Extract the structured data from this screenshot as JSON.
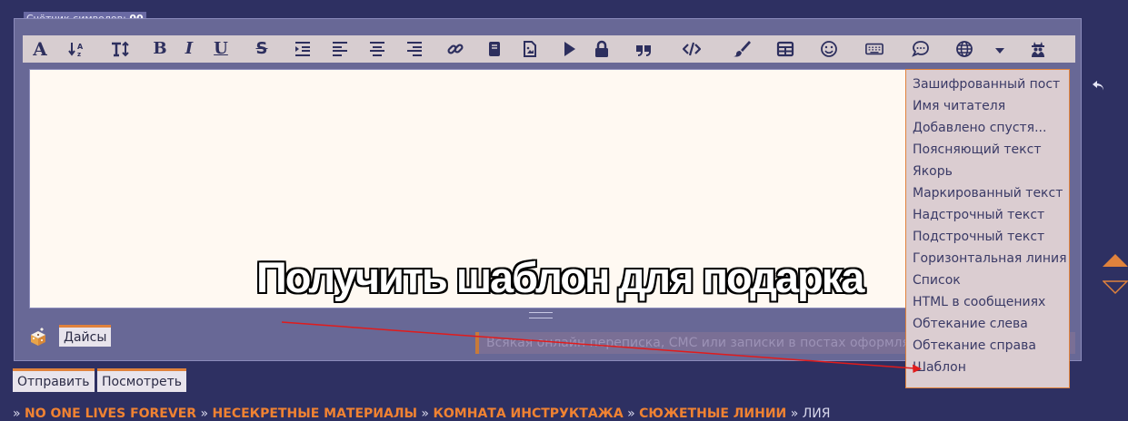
{
  "char_counter": {
    "label": "Счётчик символов:",
    "value": "00"
  },
  "toolbar": {
    "buttons": [
      {
        "icon": "font-icon"
      },
      {
        "icon": "font-size-icon"
      },
      {
        "icon": "text-height-icon"
      },
      {
        "icon": "bold-icon",
        "glyph": "B"
      },
      {
        "icon": "italic-icon",
        "glyph": "I"
      },
      {
        "icon": "underline-icon",
        "glyph": "U"
      },
      {
        "icon": "strikethrough-icon",
        "glyph": "S"
      },
      {
        "icon": "indent-icon"
      },
      {
        "icon": "align-left-icon"
      },
      {
        "icon": "align-center-icon"
      },
      {
        "icon": "align-right-icon"
      },
      {
        "icon": "link-icon"
      },
      {
        "icon": "book-icon"
      },
      {
        "icon": "image-file-icon"
      },
      {
        "icon": "play-icon"
      },
      {
        "icon": "lock-icon"
      },
      {
        "icon": "quote-icon"
      },
      {
        "icon": "code-icon"
      },
      {
        "icon": "paint-brush-icon"
      },
      {
        "icon": "table-icon"
      },
      {
        "icon": "smiley-icon"
      },
      {
        "icon": "keyboard-icon"
      },
      {
        "icon": "speech-bubble-icon"
      },
      {
        "icon": "globe-icon"
      },
      {
        "icon": "caret-down-icon"
      },
      {
        "icon": "user-secret-icon"
      }
    ]
  },
  "overlay_title": "Получить шаблон для подарка",
  "dropdown": {
    "items": [
      "Зашифрованный пост",
      "Имя читателя",
      "Добавлено спустя...",
      "Поясняющий текст",
      "Якорь",
      "Маркированный текст",
      "Надстрочный текст",
      "Подстрочный текст",
      "Горизонтальная линия",
      "Список",
      "HTML в сообщениях",
      "Обтекание слева",
      "Обтекание справа",
      "Шаблон"
    ]
  },
  "dice": {
    "label": "Дайсы"
  },
  "hint_text": "Всякая онлайн переписка, СМС или записки в постах оформля",
  "actions": {
    "submit": "Отправить",
    "preview": "Посмотреть"
  },
  "breadcrumb": {
    "separator": "»",
    "links": [
      "NO ONE LIVES FOREVER",
      "НЕСЕКРЕТНЫЕ МАТЕРИАЛЫ",
      "КОМНАТА ИНСТРУКТАЖА",
      "СЮЖЕТНЫЕ ЛИНИИ"
    ],
    "current": "ЛИЯ"
  },
  "colors": {
    "background": "#2e3062",
    "panel": "#686896",
    "toolbar": "#d7cdd0",
    "icon": "#2d2f5e",
    "accent_orange": "#e0823c",
    "link_orange": "#f08232",
    "editor_bg": "#fff9f2",
    "arrow_red": "#e11b1b"
  }
}
